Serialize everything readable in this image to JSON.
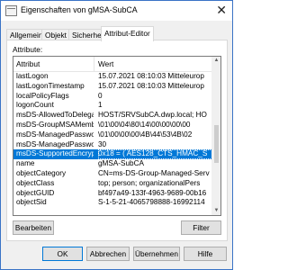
{
  "window": {
    "title": "Eigenschaften von gMSA-SubCA",
    "close_glyph": "✕"
  },
  "tabs": [
    {
      "label": "Allgemein",
      "active": false
    },
    {
      "label": "Objekt",
      "active": false
    },
    {
      "label": "Sicherheit",
      "active": false
    },
    {
      "label": "Attribut-Editor",
      "active": true
    }
  ],
  "attributes": {
    "label": "Attribute:",
    "columns": [
      "Attribut",
      "Wert"
    ],
    "rows": [
      {
        "name": "lastLogon",
        "value": "15.07.2021 08:10:03 Mitteleurop"
      },
      {
        "name": "lastLogonTimestamp",
        "value": "15.07.2021 08:10:03 Mitteleurop"
      },
      {
        "name": "localPolicyFlags",
        "value": "0"
      },
      {
        "name": "logonCount",
        "value": "1"
      },
      {
        "name": "msDS-AllowedToDelegateTo",
        "value": "HOST/SRVSubCA.dwp.local; HO"
      },
      {
        "name": "msDS-GroupMSAMembership",
        "value": "\\01\\00\\04\\80\\14\\00\\00\\00\\00"
      },
      {
        "name": "msDS-ManagedPasswordId",
        "value": "\\01\\00\\00\\00\\4B\\44\\53\\4B\\02"
      },
      {
        "name": "msDS-ManagedPasswordInterval",
        "value": "30"
      },
      {
        "name": "msDS-SupportedEncryptionTypes",
        "value": "0x18 = ( AES128_CTS_HMAC_S"
      },
      {
        "name": "name",
        "value": "gMSA-SubCA"
      },
      {
        "name": "objectCategory",
        "value": "CN=ms-DS-Group-Managed-Serv"
      },
      {
        "name": "objectClass",
        "value": "top; person; organizationalPers"
      },
      {
        "name": "objectGUID",
        "value": "bf497a49-133f-4963-9689-00b16"
      },
      {
        "name": "objectSid",
        "value": "S-1-5-21-4065798888-16992114"
      }
    ],
    "selected_index": 8,
    "scroll_up": "▲",
    "scroll_down": "▼"
  },
  "buttons": {
    "edit": "Bearbeiten",
    "filter": "Filter",
    "ok": "OK",
    "cancel": "Abbrechen",
    "apply": "Übernehmen",
    "help": "Hilfe"
  },
  "colors": {
    "selection": "#0078d7",
    "dialog_bg": "#f0f0f0",
    "border": "#3a73c6"
  }
}
